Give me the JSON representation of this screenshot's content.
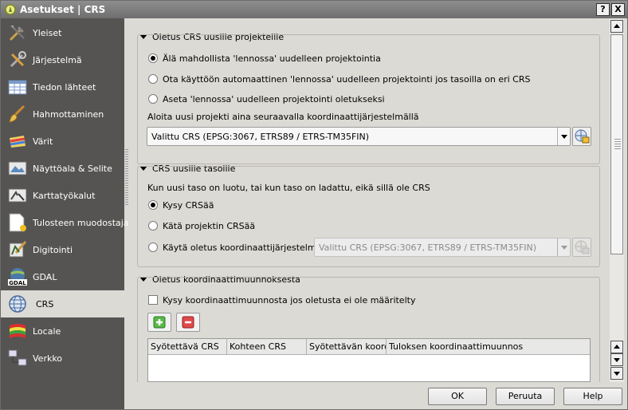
{
  "window": {
    "title": "Asetukset | CRS",
    "help_label": "?",
    "close_label": "X"
  },
  "sidebar": {
    "items": [
      {
        "label": "Yleiset",
        "icon": "tools-icon"
      },
      {
        "label": "Järjestelmä",
        "icon": "system-tools-icon"
      },
      {
        "label": "Tiedon lähteet",
        "icon": "table-icon"
      },
      {
        "label": "Hahmottaminen",
        "icon": "brush-icon"
      },
      {
        "label": "Värit",
        "icon": "color-palette-icon"
      },
      {
        "label": "Näyttöala & Selite",
        "icon": "map-canvas-icon"
      },
      {
        "label": "Karttatyökalut",
        "icon": "map-tools-icon"
      },
      {
        "label": "Tulosteen muodostaja",
        "icon": "composer-icon"
      },
      {
        "label": "Digitointi",
        "icon": "digitizing-icon"
      },
      {
        "label": "GDAL",
        "icon": "gdal-icon"
      },
      {
        "label": "CRS",
        "icon": "globe-icon",
        "selected": true
      },
      {
        "label": "Locale",
        "icon": "flag-icon"
      },
      {
        "label": "Verkko",
        "icon": "network-icon"
      }
    ]
  },
  "projects": {
    "header": "Oletus CRS uusille projekteille",
    "radio_no_otf": "Älä mahdollista 'lennossa' uudelleen projektointia",
    "radio_auto_otf": "Ota käyttöön automaattinen 'lennossa' uudelleen projektointi jos tasoilla on eri CRS",
    "radio_default_otf": "Aseta 'lennossa' uudelleen projektointi oletukseksi",
    "start_label": "Aloita uusi projekti aina seuraavalla koordinaattijärjestelmällä",
    "crs_value": "Valittu CRS (EPSG:3067, ETRS89 / ETRS-TM35FIN)"
  },
  "layers": {
    "header": "CRS uusille tasoille",
    "desc": "Kun uusi taso on luotu, tai kun taso on ladattu, eikä sillä ole CRS",
    "radio_prompt": "Kysy CRSää",
    "radio_project": "Kätä projektin CRSää",
    "radio_default": "Käytä oletus koordinaattijärjestelmää",
    "default_crs_value": "Valittu CRS (EPSG:3067, ETRS89 / ETRS-TM35FIN)"
  },
  "transforms": {
    "header": "Oletus koordinaattimuunnoksesta",
    "ask_label": "Kysy koordinaattimuunnosta jos oletusta ei ole määritelty",
    "columns": [
      "Syötettävä CRS",
      "Kohteen CRS",
      "Syötettävän koordi",
      "Tuloksen koordinaattimuunnos"
    ]
  },
  "footer": {
    "ok": "OK",
    "cancel": "Peruuta",
    "help": "Help"
  }
}
